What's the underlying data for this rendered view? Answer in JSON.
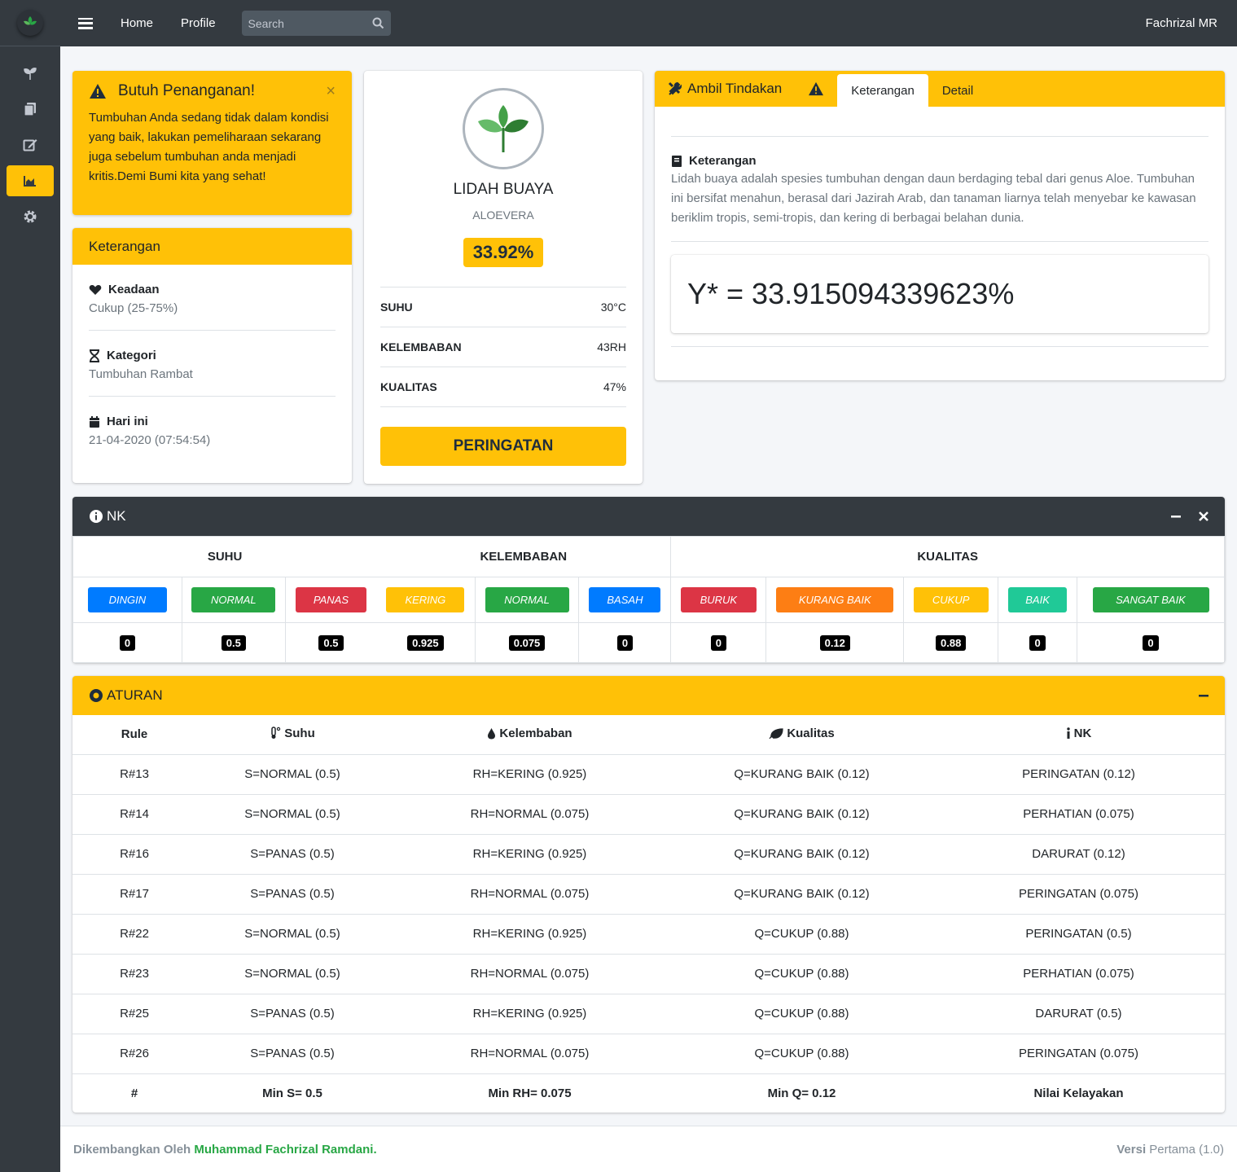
{
  "topbar": {
    "home": "Home",
    "profile": "Profile",
    "search_placeholder": "Search",
    "user": "Fachrizal MR"
  },
  "sidebar": {
    "items": [
      "seedling",
      "copy",
      "edit",
      "chart-area",
      "cog"
    ],
    "active": "chart-area"
  },
  "alert": {
    "title": "Butuh Penanganan!",
    "text": "Tumbuhan Anda sedang tidak dalam kondisi yang baik, lakukan pemeliharaan sekarang juga sebelum tumbuhan anda menjadi kritis.Demi Bumi kita yang sehat!",
    "close": "×"
  },
  "keterangan": {
    "title": "Keterangan",
    "keadaan_label": "Keadaan",
    "keadaan_value": "Cukup (25-75%)",
    "kategori_label": "Kategori",
    "kategori_value": "Tumbuhan Rambat",
    "hari_label": "Hari ini",
    "hari_value": "21-04-2020 (07:54:54)"
  },
  "plant": {
    "name": "LIDAH BUAYA",
    "latin": "ALOEVERA",
    "score": "33.92%",
    "stats": [
      {
        "label": "SUHU",
        "value": "30°C"
      },
      {
        "label": "KELEMBABAN",
        "value": "43RH"
      },
      {
        "label": "KUALITAS",
        "value": "47%"
      }
    ],
    "button": "PERINGATAN"
  },
  "action": {
    "title": "Ambil Tindakan",
    "tab_keterangan": "Keterangan",
    "tab_detail": "Detail",
    "desc_title": "Keterangan",
    "desc_text": "Lidah buaya adalah spesies tumbuhan dengan daun berdaging tebal dari genus Aloe. Tumbuhan ini bersifat menahun, berasal dari Jazirah Arab, dan tanaman liarnya telah menyebar ke kawasan beriklim tropis, semi-tropis, dan kering di berbagai belahan dunia.",
    "formula": "Y* = 33.915094339623%"
  },
  "nk": {
    "title": "NK",
    "groups": [
      "SUHU",
      "KELEMBABAN",
      "KUALITAS"
    ],
    "labels": [
      {
        "text": "DINGIN",
        "color": "#007bff"
      },
      {
        "text": "NORMAL",
        "color": "#28a745"
      },
      {
        "text": "PANAS",
        "color": "#dc3545"
      },
      {
        "text": "KERING",
        "color": "#ffc107"
      },
      {
        "text": "NORMAL",
        "color": "#28a745"
      },
      {
        "text": "BASAH",
        "color": "#007bff"
      },
      {
        "text": "BURUK",
        "color": "#dc3545"
      },
      {
        "text": "KURANG BAIK",
        "color": "#fd7e14"
      },
      {
        "text": "CUKUP",
        "color": "#ffc107"
      },
      {
        "text": "BAIK",
        "color": "#20c997"
      },
      {
        "text": "SANGAT BAIK",
        "color": "#28a745"
      }
    ],
    "values": [
      "0",
      "0.5",
      "0.5",
      "0.925",
      "0.075",
      "0",
      "0",
      "0.12",
      "0.88",
      "0",
      "0"
    ]
  },
  "rules": {
    "title": "ATURAN",
    "headers": [
      "Rule",
      "Suhu",
      "Kelembaban",
      "Kualitas",
      "NK"
    ],
    "rows": [
      [
        "R#13",
        "S=NORMAL (0.5)",
        "RH=KERING (0.925)",
        "Q=KURANG BAIK (0.12)",
        "PERINGATAN (0.12)"
      ],
      [
        "R#14",
        "S=NORMAL (0.5)",
        "RH=NORMAL (0.075)",
        "Q=KURANG BAIK (0.12)",
        "PERHATIAN (0.075)"
      ],
      [
        "R#16",
        "S=PANAS (0.5)",
        "RH=KERING (0.925)",
        "Q=KURANG BAIK (0.12)",
        "DARURAT (0.12)"
      ],
      [
        "R#17",
        "S=PANAS (0.5)",
        "RH=NORMAL (0.075)",
        "Q=KURANG BAIK (0.12)",
        "PERINGATAN (0.075)"
      ],
      [
        "R#22",
        "S=NORMAL (0.5)",
        "RH=KERING (0.925)",
        "Q=CUKUP (0.88)",
        "PERINGATAN (0.5)"
      ],
      [
        "R#23",
        "S=NORMAL (0.5)",
        "RH=NORMAL (0.075)",
        "Q=CUKUP (0.88)",
        "PERHATIAN (0.075)"
      ],
      [
        "R#25",
        "S=PANAS (0.5)",
        "RH=KERING (0.925)",
        "Q=CUKUP (0.88)",
        "DARURAT (0.5)"
      ],
      [
        "R#26",
        "S=PANAS (0.5)",
        "RH=NORMAL (0.075)",
        "Q=CUKUP (0.88)",
        "PERINGATAN (0.075)"
      ]
    ],
    "footer": [
      "#",
      "Min S= 0.5",
      "Min RH= 0.075",
      "Min Q= 0.12",
      "Nilai Kelayakan"
    ]
  },
  "footer": {
    "dev_prefix": "Dikembangkan Oleh",
    "dev_name": "Muhammad Fachrizal Ramdani.",
    "ver_label": "Versi",
    "ver_value": "Pertama (1.0)"
  }
}
